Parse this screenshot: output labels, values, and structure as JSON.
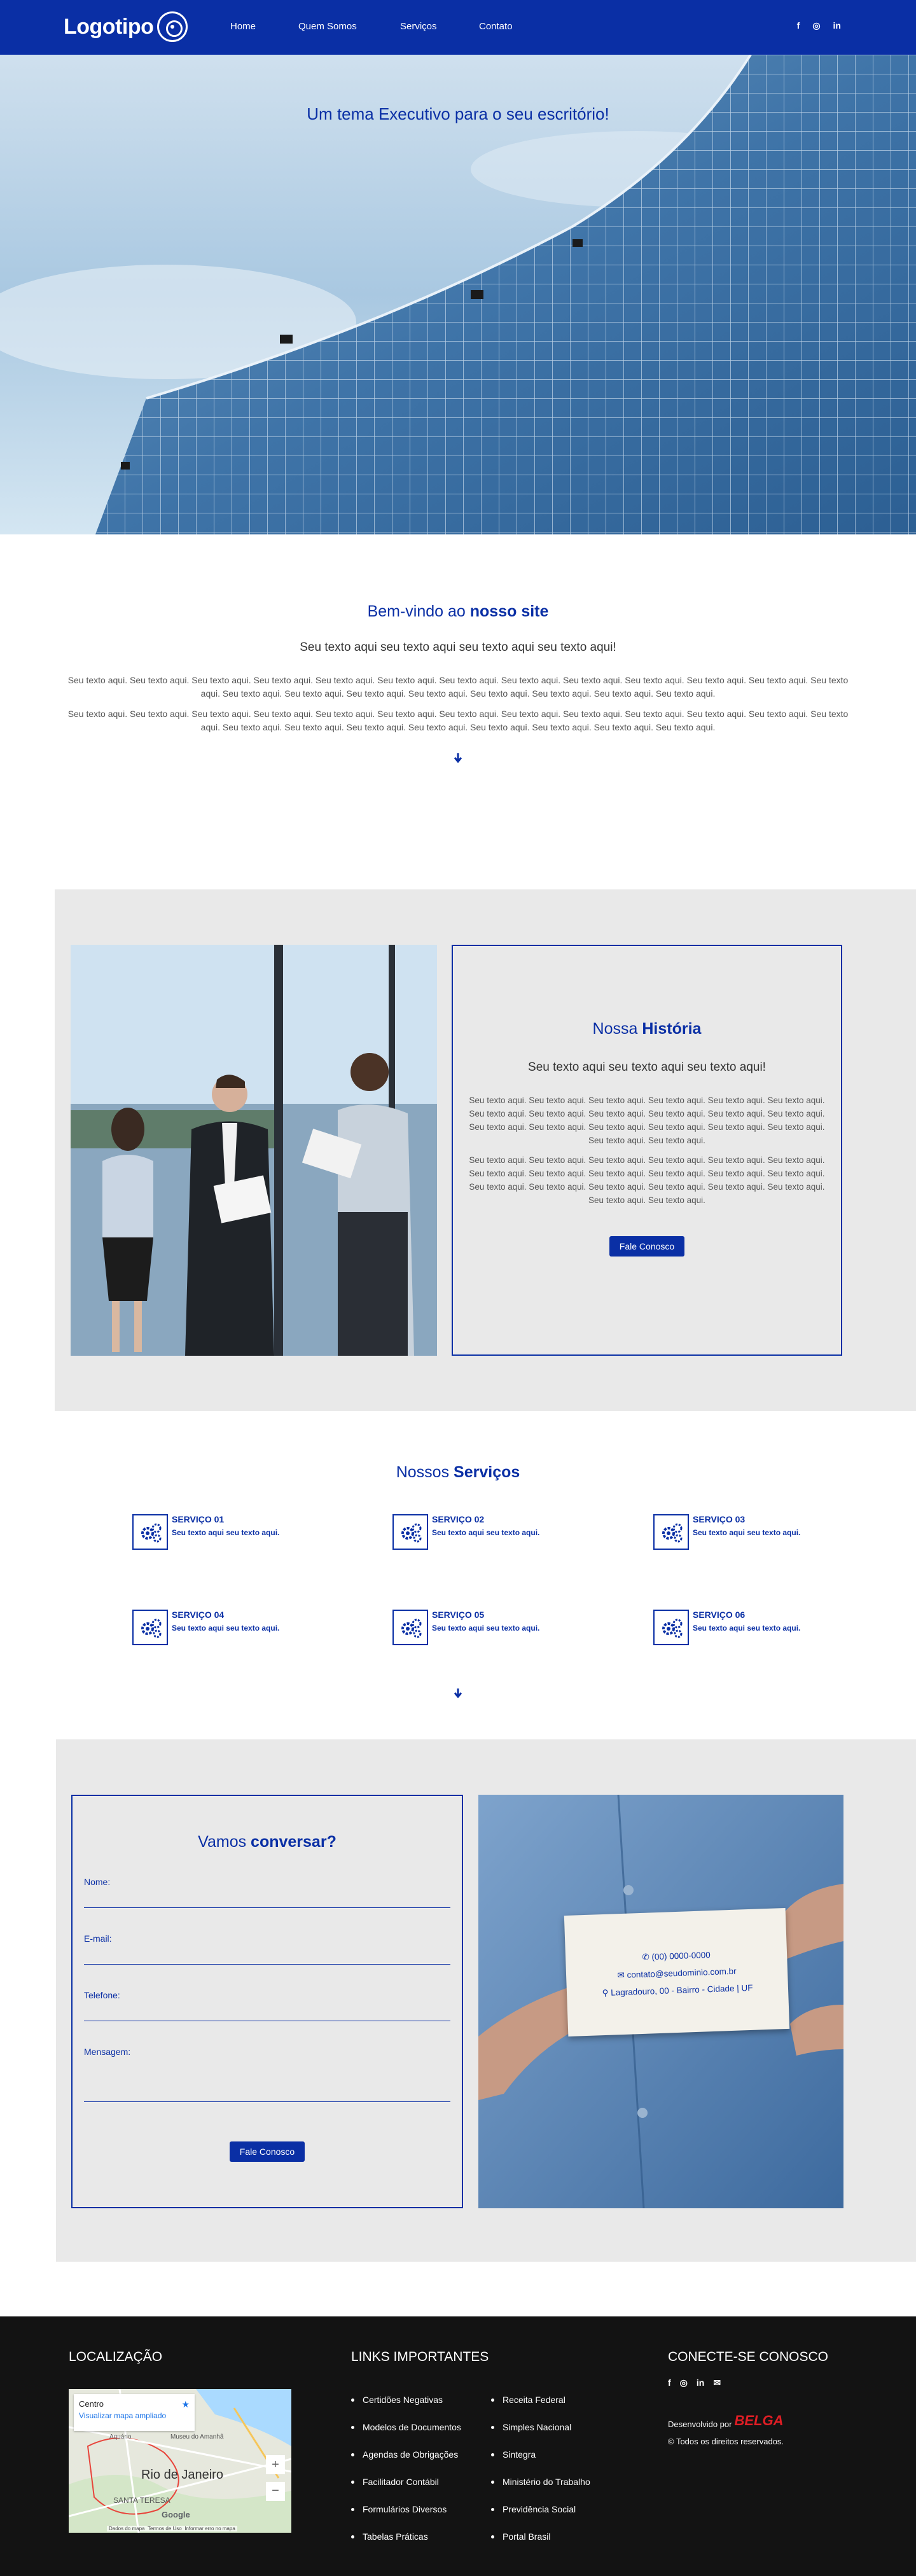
{
  "header": {
    "logo_text": "Logotipo",
    "nav": [
      "Home",
      "Quem Somos",
      "Serviços",
      "Contato"
    ],
    "social": [
      "f",
      "◎",
      "in"
    ]
  },
  "hero": {
    "tagline": "Um tema Executivo para o seu escritório!"
  },
  "welcome": {
    "title_pre": "Bem-vindo ao ",
    "title_bold": "nosso site",
    "subtitle": "Seu texto aqui seu texto aqui seu texto aqui seu texto aqui!",
    "para1": "Seu texto aqui. Seu texto aqui. Seu texto aqui. Seu texto aqui. Seu texto aqui. Seu texto aqui. Seu texto aqui. Seu texto aqui. Seu texto aqui. Seu texto aqui. Seu texto aqui. Seu texto aqui. Seu texto aqui. Seu texto aqui. Seu texto aqui. Seu texto aqui. Seu texto aqui. Seu texto aqui. Seu texto aqui. Seu texto aqui. Seu texto aqui.",
    "para2": "Seu texto aqui. Seu texto aqui. Seu texto aqui. Seu texto aqui. Seu texto aqui. Seu texto aqui. Seu texto aqui. Seu texto aqui. Seu texto aqui. Seu texto aqui. Seu texto aqui. Seu texto aqui. Seu texto aqui. Seu texto aqui. Seu texto aqui. Seu texto aqui. Seu texto aqui. Seu texto aqui. Seu texto aqui. Seu texto aqui. Seu texto aqui."
  },
  "history": {
    "title_pre": "Nossa ",
    "title_bold": "História",
    "subtitle": "Seu texto aqui seu texto aqui seu texto aqui!",
    "para1": "Seu texto aqui. Seu texto aqui. Seu texto aqui. Seu texto aqui. Seu texto aqui. Seu texto aqui. Seu texto aqui. Seu texto aqui. Seu texto aqui. Seu texto aqui. Seu texto aqui. Seu texto aqui. Seu texto aqui. Seu texto aqui. Seu texto aqui. Seu texto aqui. Seu texto aqui. Seu texto aqui. Seu texto aqui. Seu texto aqui.",
    "para2": "Seu texto aqui. Seu texto aqui. Seu texto aqui. Seu texto aqui. Seu texto aqui. Seu texto aqui. Seu texto aqui. Seu texto aqui. Seu texto aqui. Seu texto aqui. Seu texto aqui. Seu texto aqui. Seu texto aqui. Seu texto aqui. Seu texto aqui. Seu texto aqui. Seu texto aqui. Seu texto aqui. Seu texto aqui. Seu texto aqui.",
    "button": "Fale Conosco"
  },
  "services": {
    "title_pre": "Nossos ",
    "title_bold": "Serviços",
    "items": [
      {
        "title": "SERVIÇO 01",
        "text": "Seu texto aqui seu texto aqui."
      },
      {
        "title": "SERVIÇO 02",
        "text": "Seu texto aqui seu texto aqui."
      },
      {
        "title": "SERVIÇO 03",
        "text": "Seu texto aqui seu texto aqui."
      },
      {
        "title": "SERVIÇO 04",
        "text": "Seu texto aqui seu texto aqui."
      },
      {
        "title": "SERVIÇO 05",
        "text": "Seu texto aqui seu texto aqui."
      },
      {
        "title": "SERVIÇO 06",
        "text": "Seu texto aqui seu texto aqui."
      }
    ]
  },
  "contact": {
    "title_pre": "Vamos ",
    "title_bold": "conversar?",
    "fields": [
      "Nome:",
      "E-mail:",
      "Telefone:",
      "Mensagem:"
    ],
    "button": "Fale Conosco",
    "card": {
      "phone": "(00) 0000-0000",
      "email": "contato@seudominio.com.br",
      "address": "Lagradouro, 00 - Bairro - Cidade | UF"
    }
  },
  "footer": {
    "location_title": "LOCALIZAÇÃO",
    "map": {
      "place": "Centro",
      "view_link": "Visualizar mapa ampliado",
      "labels": [
        "Rio de Janeiro",
        "SANTA TERESA",
        "Museu do Amanhã",
        "Aquário",
        "Google"
      ],
      "attribution": [
        "Dados do mapa",
        "Termos de Uso",
        "Informar erro no mapa"
      ]
    },
    "links_title": "LINKS IMPORTANTES",
    "links_col1": [
      "Certidões Negativas",
      "Modelos de Documentos",
      "Agendas de Obrigações",
      "Facilitador Contábil",
      "Formulários Diversos",
      "Tabelas Práticas"
    ],
    "links_col2": [
      "Receita Federal",
      "Simples Nacional",
      "Sintegra",
      "Ministério do Trabalho",
      "Previdência Social",
      "Portal Brasil"
    ],
    "connect_title": "CONECTE-SE CONOSCO",
    "social": [
      "f",
      "◎",
      "in",
      "✉"
    ],
    "developed_by": "Desenvolvido por",
    "developer": "BELGA",
    "rights": "© Todos os direitos reservados."
  },
  "colors": {
    "brand": "#0a2fa5",
    "footer_bg": "#131313",
    "panel_bg": "#e9e9e9",
    "developer": "#e01e25"
  }
}
